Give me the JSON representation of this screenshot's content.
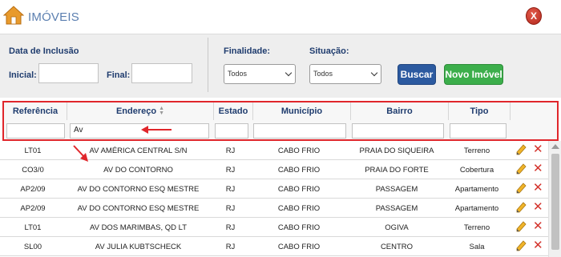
{
  "header": {
    "title": "IMÓVEIS",
    "close_label": "X"
  },
  "filters": {
    "date_group_label": "Data de Inclusão",
    "initial_label": "Inicial:",
    "final_label": "Final:",
    "purpose_label": "Finalidade:",
    "purpose_value": "Todos",
    "status_label": "Situação:",
    "status_value": "Todos",
    "search_button": "Buscar",
    "new_button": "Novo Imóvel"
  },
  "table": {
    "columns": [
      "Referência",
      "Endereço",
      "Estado",
      "Município",
      "Bairro",
      "Tipo"
    ],
    "address_filter_value": "Av",
    "rows": [
      {
        "ref": "LT01",
        "address": "AV AMÉRICA CENTRAL S/N",
        "state": "RJ",
        "city": "CABO FRIO",
        "district": "PRAIA DO SIQUEIRA",
        "type": "Terreno"
      },
      {
        "ref": "CO3/0",
        "address": "AV DO CONTORNO",
        "state": "RJ",
        "city": "CABO FRIO",
        "district": "PRAIA DO FORTE",
        "type": "Cobertura"
      },
      {
        "ref": "AP2/09",
        "address": "AV DO CONTORNO ESQ MESTRE",
        "state": "RJ",
        "city": "CABO FRIO",
        "district": "PASSAGEM",
        "type": "Apartamento"
      },
      {
        "ref": "AP2/09",
        "address": "AV DO CONTORNO ESQ MESTRE",
        "state": "RJ",
        "city": "CABO FRIO",
        "district": "PASSAGEM",
        "type": "Apartamento"
      },
      {
        "ref": "LT01",
        "address": "AV DOS MARIMBAS, QD LT",
        "state": "RJ",
        "city": "CABO FRIO",
        "district": "OGIVA",
        "type": "Terreno"
      },
      {
        "ref": "SL00",
        "address": "AV JULIA KUBTSCHECK",
        "state": "RJ",
        "city": "CABO FRIO",
        "district": "CENTRO",
        "type": "Sala"
      }
    ]
  },
  "icons": {
    "home": "home-icon",
    "edit": "pencil-icon",
    "delete": "delete-x-icon",
    "close": "close-icon"
  },
  "colors": {
    "accent_blue": "#2c5aa0",
    "accent_green": "#3cae4b",
    "highlight_red": "#e0262b",
    "label_navy": "#1f3c6e"
  }
}
